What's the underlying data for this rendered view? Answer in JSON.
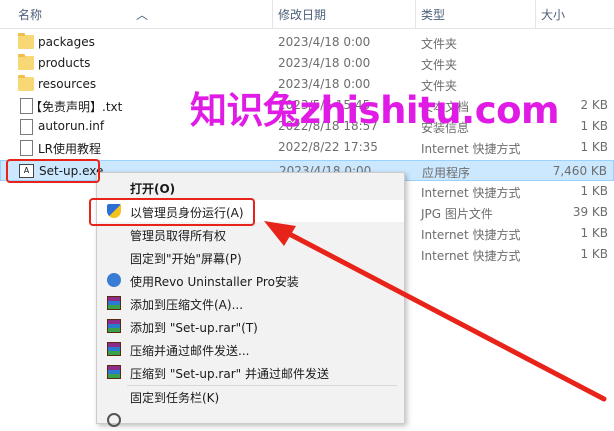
{
  "columns": {
    "name": "名称",
    "date": "修改日期",
    "type": "类型",
    "size": "大小"
  },
  "files": [
    {
      "name": "packages",
      "date": "2023/4/18 0:00",
      "type": "文件夹",
      "size": "",
      "icon": "folder-icon"
    },
    {
      "name": "products",
      "date": "2023/4/18 0:00",
      "type": "文件夹",
      "size": "",
      "icon": "folder-icon"
    },
    {
      "name": "resources",
      "date": "2023/4/18 0:00",
      "type": "文件夹",
      "size": "",
      "icon": "folder-icon"
    },
    {
      "name": "【免责声明】.txt",
      "date": "2023/5/6 15:45",
      "type": "文本文档",
      "size": "2 KB",
      "icon": "text-file-icon"
    },
    {
      "name": "autorun.inf",
      "date": "2022/8/18 18:57",
      "type": "安装信息",
      "size": "1 KB",
      "icon": "settings-file-icon"
    },
    {
      "name": "LR使用教程",
      "date": "2022/8/22 17:35",
      "type": "Internet 快捷方式",
      "size": "1 KB",
      "icon": "shortcut-icon"
    },
    {
      "name": "Set-up.exe",
      "date": "2023/4/18 0:00",
      "type": "应用程序",
      "size": "7,460 KB",
      "icon": "app-icon",
      "selected": true
    },
    {
      "name": "",
      "date": "",
      "type": "Internet 快捷方式",
      "size": "1 KB",
      "icon": ""
    },
    {
      "name": "",
      "date": "",
      "type": "JPG 图片文件",
      "size": "39 KB",
      "icon": ""
    },
    {
      "name": "",
      "date": "",
      "type": "Internet 快捷方式",
      "size": "1 KB",
      "icon": ""
    },
    {
      "name": "",
      "date": "",
      "type": "Internet 快捷方式",
      "size": "1 KB",
      "icon": ""
    }
  ],
  "context_menu": {
    "items": [
      {
        "label": "打开(O)",
        "bold": true,
        "icon": ""
      },
      {
        "label": "以管理员身份运行(A)",
        "icon": "uac-shield-icon"
      },
      {
        "label": "管理员取得所有权",
        "icon": ""
      },
      {
        "label": "固定到\"开始\"屏幕(P)",
        "icon": ""
      },
      {
        "label": "使用Revo Uninstaller Pro安装",
        "icon": "revo-icon"
      },
      {
        "label": "添加到压缩文件(A)...",
        "icon": "winrar-icon"
      },
      {
        "label": "添加到 \"Set-up.rar\"(T)",
        "icon": "winrar-icon"
      },
      {
        "label": "压缩并通过邮件发送...",
        "icon": "winrar-icon"
      },
      {
        "label": "压缩到 \"Set-up.rar\" 并通过邮件发送",
        "icon": "winrar-icon"
      },
      {
        "label": "固定到任务栏(K)",
        "icon": ""
      }
    ]
  },
  "watermark": "知识兔zhishitu.com",
  "colors": {
    "highlight": "#e8231a",
    "watermark": "#e11be6",
    "selection": "#cce8ff"
  }
}
